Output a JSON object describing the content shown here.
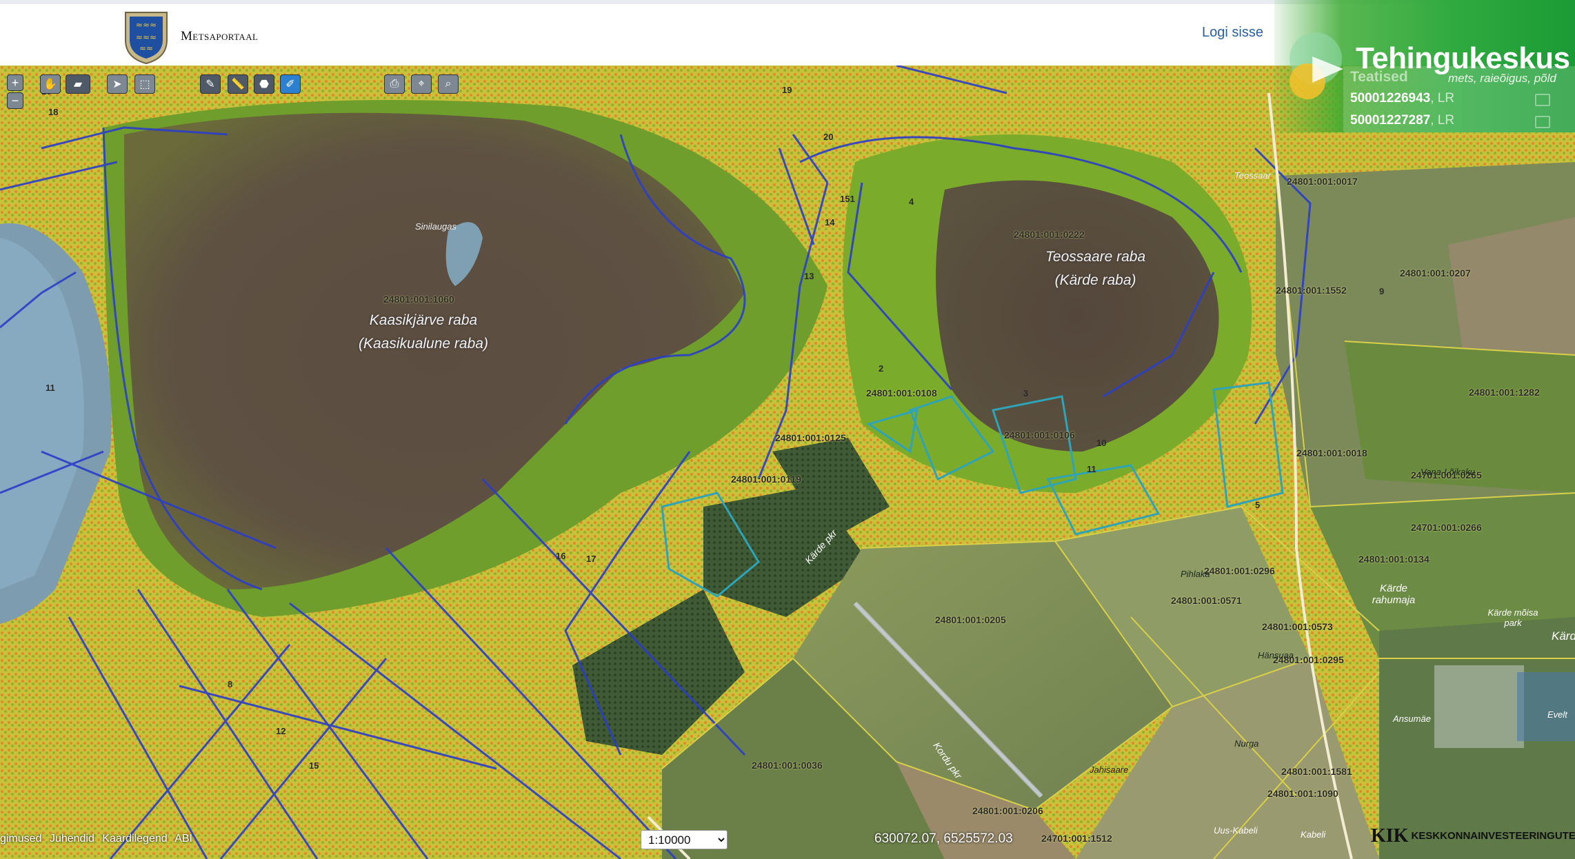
{
  "header": {
    "portal_title": "Metsaportaal",
    "login_label": "Logi sisse"
  },
  "brand": {
    "name": "Tehingukeskus",
    "tagline": "mets, raieõigus, põld"
  },
  "notices": {
    "title": "Teatised",
    "items": [
      {
        "id": "50001226943",
        "suffix": ", LR"
      },
      {
        "id": "50001227287",
        "suffix": ", LR"
      }
    ]
  },
  "toolbar": {
    "zoom_in": "+",
    "zoom_out": "−"
  },
  "map": {
    "place_labels": [
      {
        "line1": "Kaasikjärve raba",
        "line2": "(Kaasikualune raba)"
      },
      {
        "line1": "Teossaare raba",
        "line2": "(Kärde raba)"
      }
    ],
    "plot_labels": [
      "24801:001:1060",
      "24801:001:0222",
      "24801:001:0017",
      "24801:001:0207",
      "24801:001:1552",
      "24801:001:0108",
      "24801:001:0125",
      "24801:001:0106",
      "24801:001:1282",
      "24801:001:0018",
      "24701:001:0265",
      "24701:001:0266",
      "24801:001:0296",
      "24801:001:0571",
      "24801:001:0205",
      "24801:001:0573",
      "24801:001:0295",
      "24801:001:0036",
      "24801:001:0206",
      "24701:001:1512",
      "24801:001:1090",
      "24801:001:0134",
      "24801:001:1581",
      "24801:001:0119"
    ],
    "numbers": [
      "19",
      "18",
      "10",
      "11",
      "14",
      "13",
      "16",
      "17",
      "12",
      "20",
      "151",
      "15",
      "2",
      "3",
      "4",
      "5",
      "8",
      "9",
      "10",
      "11"
    ],
    "roads": [
      "Kärde pkr",
      "Kordu pkr"
    ],
    "villages": [
      "Sinilaugas",
      "Teossaar",
      "Pihlaka",
      "Kärde rahumaja",
      "Kärde mõisa park",
      "Kärd",
      "Jahisaare",
      "Nurga",
      "Uus-Kabeli",
      "Kabeli",
      "Ansumäe",
      "Evelt",
      "Hänsuaa",
      "Vana-Lõikaku"
    ]
  },
  "footer": {
    "links": [
      "gimused",
      "Juhendid",
      "Kaardilegend",
      "ABI"
    ],
    "scale_options": [
      "1:10000"
    ],
    "coordinates": "630072.07, 6525572.03",
    "partner": "KESKKONNAINVESTEERINGUTE KESKUS",
    "partner_mark": "KIK"
  }
}
